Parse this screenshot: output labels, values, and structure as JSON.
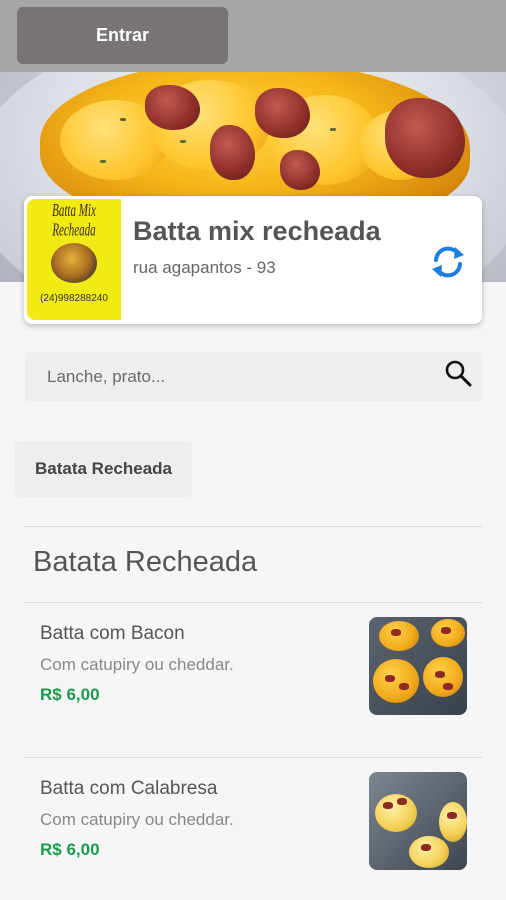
{
  "header": {
    "login_label": "Entrar"
  },
  "store": {
    "name": "Batta mix recheada",
    "address": "rua agapantos - 93",
    "logo_title": "Batta Mix Recheada",
    "logo_phone": "(24)998288240",
    "refresh_icon": "refresh-icon"
  },
  "search": {
    "placeholder": "Lanche, prato...",
    "value": "",
    "icon": "search-icon"
  },
  "categories": [
    {
      "label": "Batata Recheada"
    }
  ],
  "section": {
    "title": "Batata Recheada"
  },
  "products": [
    {
      "name": "Batta com Bacon",
      "description": "Com catupiry ou cheddar.",
      "price": "R$ 6,00"
    },
    {
      "name": "Batta com Calabresa",
      "description": "Com catupiry ou cheddar.",
      "price": "R$ 6,00"
    }
  ],
  "colors": {
    "accent_blue": "#1e7ee0",
    "price_green": "#1e9a50",
    "topbar": "#a6a6a6",
    "login_button": "#787473"
  }
}
